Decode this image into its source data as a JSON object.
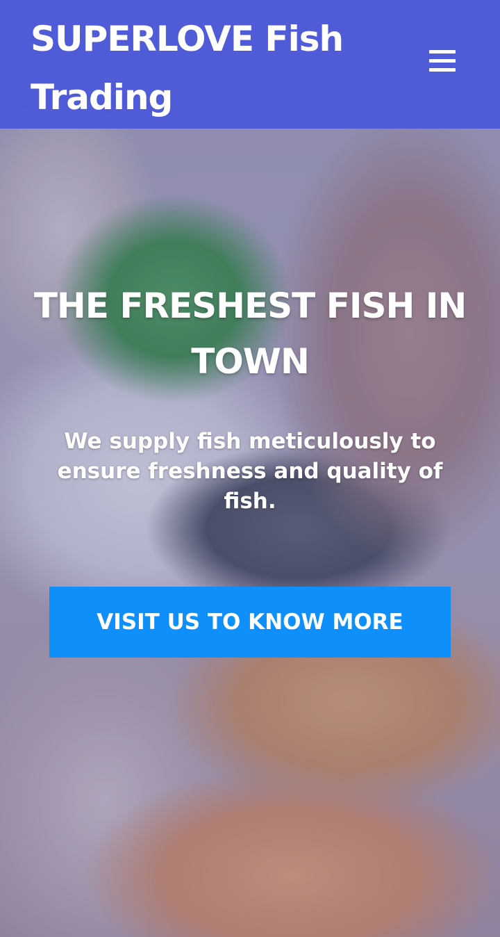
{
  "header": {
    "site_title": "SUPERLOVE Fish Trading",
    "menu_icon": "hamburger-menu-icon"
  },
  "hero": {
    "headline": "THE FRESHEST FISH IN TOWN",
    "subtext": "We supply fish meticulously to ensure freshness and quality of fish.",
    "cta_label": "VISIT US TO KNOW MORE",
    "background_description": "seafood"
  },
  "colors": {
    "header_background": "#4b58da",
    "cta_background": "#0e8ffa",
    "text": "#ffffff"
  }
}
